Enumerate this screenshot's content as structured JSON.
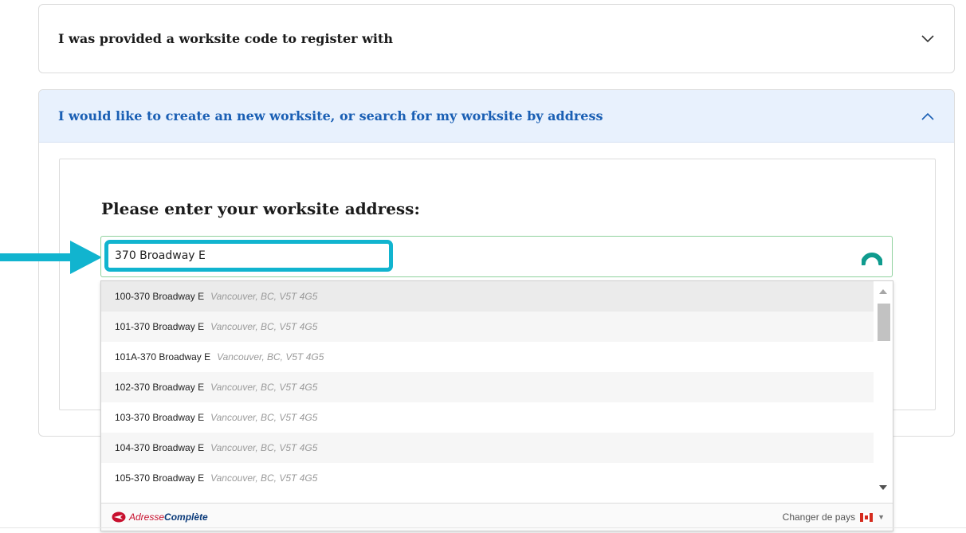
{
  "accordion": {
    "code_option": {
      "title": "I was provided a worksite code to register with",
      "chevron": "chevron-down-icon"
    },
    "address_option": {
      "title": "I would like to create an new worksite, or search for my worksite by address",
      "chevron": "chevron-up-icon"
    }
  },
  "address_form": {
    "heading": "Please enter your worksite address:",
    "input_value": "370 Broadway E"
  },
  "suggestions": [
    {
      "line": "100-370 Broadway E",
      "desc": "Vancouver, BC, V5T 4G5"
    },
    {
      "line": "101-370 Broadway E",
      "desc": "Vancouver, BC, V5T 4G5"
    },
    {
      "line": "101A-370 Broadway E",
      "desc": "Vancouver, BC, V5T 4G5"
    },
    {
      "line": "102-370 Broadway E",
      "desc": "Vancouver, BC, V5T 4G5"
    },
    {
      "line": "103-370 Broadway E",
      "desc": "Vancouver, BC, V5T 4G5"
    },
    {
      "line": "104-370 Broadway E",
      "desc": "Vancouver, BC, V5T 4G5"
    },
    {
      "line": "105-370 Broadway E",
      "desc": "Vancouver, BC, V5T 4G5"
    }
  ],
  "footer": {
    "brand_part1": "Adresse",
    "brand_part2": "Complète",
    "change_country": "Changer de pays"
  },
  "colors": {
    "highlight": "#11b4cf",
    "link_blue": "#1a5fb4",
    "header_bg": "#e8f1fd",
    "brand_red": "#c8102e"
  }
}
